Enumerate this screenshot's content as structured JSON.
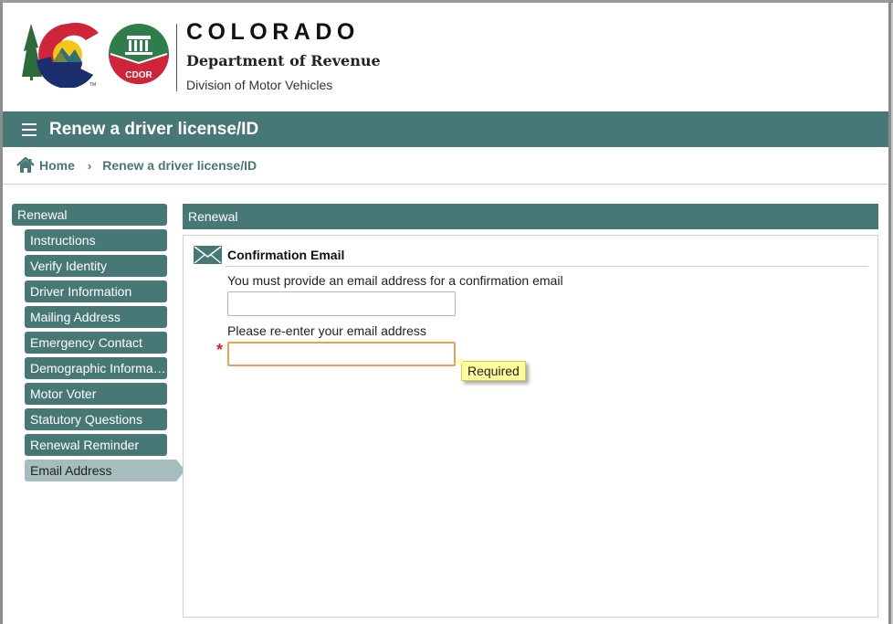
{
  "header": {
    "state_name": "COLORADO",
    "department": "Department of Revenue",
    "division": "Division of Motor Vehicles",
    "cdor_badge": "CDOR",
    "trademark": "TM"
  },
  "titlebar": {
    "menu_icon": "hamburger-menu-icon",
    "title": "Renew a driver license/ID"
  },
  "breadcrumb": {
    "home_icon": "home-icon",
    "home_label": "Home",
    "separator": "›",
    "current_label": "Renew a driver license/ID"
  },
  "sidebar": {
    "group_label": "Renewal",
    "items": [
      {
        "label": "Instructions",
        "active": false
      },
      {
        "label": "Verify Identity",
        "active": false
      },
      {
        "label": "Driver Information",
        "active": false
      },
      {
        "label": "Mailing Address",
        "active": false
      },
      {
        "label": "Emergency Contact",
        "active": false
      },
      {
        "label": "Demographic Information",
        "active": false
      },
      {
        "label": "Motor Voter",
        "active": false
      },
      {
        "label": "Statutory Questions",
        "active": false
      },
      {
        "label": "Renewal Reminder",
        "active": false
      },
      {
        "label": "Email Address",
        "active": true
      }
    ]
  },
  "panel": {
    "header": "Renewal",
    "section_icon": "envelope-icon",
    "section_title": "Confirmation Email",
    "fields": [
      {
        "label": "You must provide an email address for a confirmation email",
        "value": "",
        "placeholder": "",
        "required": false,
        "invalid": false
      },
      {
        "label": "Please re-enter your email address",
        "value": "",
        "placeholder": "",
        "required": true,
        "invalid": true
      }
    ],
    "required_marker": "*",
    "validation_tooltip": "Required"
  },
  "colors": {
    "brand_teal": "#487876",
    "active_step": "#a5bdbd",
    "invalid_border": "#e8a154",
    "tooltip_bg": "#fdfd9c",
    "required_star": "#e02020"
  }
}
